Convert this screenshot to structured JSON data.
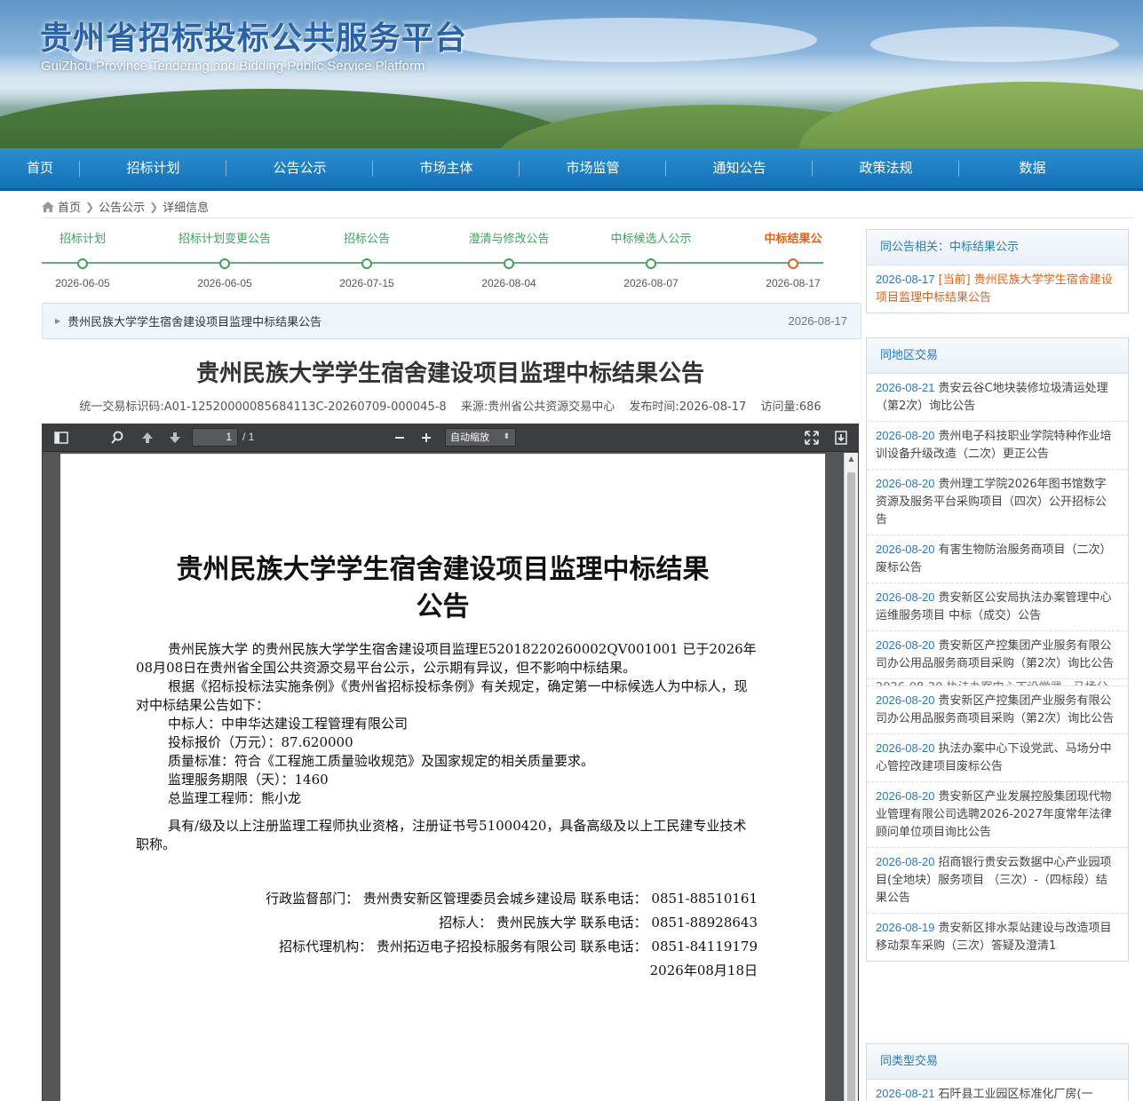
{
  "site": {
    "title": "贵州省招标投标公共服务平台",
    "subtitle": "GuiZhou Province Tendering and Bidding Public Service Platform"
  },
  "nav": [
    "首页",
    "招标计划",
    "公告公示",
    "市场主体",
    "市场监管",
    "通知公告",
    "政策法规",
    "数据"
  ],
  "breadcrumb": [
    "首页",
    "公告公示",
    "详细信息"
  ],
  "timeline": [
    {
      "label": "招标计划",
      "date": "2026-06-05"
    },
    {
      "label": "招标计划变更公告",
      "date": "2026-06-05"
    },
    {
      "label": "招标公告",
      "date": "2026-07-15"
    },
    {
      "label": "澄清与修改公告",
      "date": "2026-08-04"
    },
    {
      "label": "中标候选人公示",
      "date": "2026-08-07"
    },
    {
      "label": "中标结果公",
      "date": "2026-08-17",
      "current": true
    }
  ],
  "related_bar": {
    "title": "贵州民族大学学生宿舍建设项目监理中标结果公告",
    "date": "2026-08-17"
  },
  "article": {
    "title": "贵州民族大学学生宿舍建设项目监理中标结果公告",
    "trade_id": "统一交易标识码:A01-12520000085684113C-20260709-000045-8",
    "source": "来源:贵州省公共资源交易中心",
    "publish_time": "发布时间:2026-08-17",
    "visits": "访问量:686"
  },
  "pdf": {
    "page_current": "1",
    "page_total": "/ 1",
    "zoom": "自动缩放",
    "doc_title_line1": "贵州民族大学学生宿舍建设项目监理中标结果",
    "doc_title_line2": "公告",
    "para1": "贵州民族大学  的贵州民族大学学生宿舍建设项目监理E52018220260002QV001001  已于2026年08月08日在贵州省全国公共资源交易平台公示，公示期有异议，但不影响中标结果。",
    "para2": "根据《招标投标法实施条例》《贵州省招标投标条例》有关规定，确定第一中标候选人为中标人，现对中标结果公告如下：",
    "winner": "中标人：中申华达建设工程管理有限公司",
    "price": "投标报价（万元）：87.620000",
    "quality": "质量标准：符合《工程施工质量验收规范》及国家规定的相关质量要求。",
    "period": "监理服务期限（天）：1460",
    "chief": "总监理工程师：熊小龙",
    "qualification": "具有/级及以上注册监理工程师执业资格，注册证书号51000420，具备高级及以上工民建专业技术职称。",
    "footer": [
      "行政监督部门：  贵州贵安新区管理委员会城乡建设局  联系电话：  0851-88510161",
      "招标人：  贵州民族大学  联系电话：  0851-88928643",
      "招标代理机构：  贵州拓迈电子招投标服务有限公司  联系电话：  0851-84119179",
      "2026年08月18日"
    ]
  },
  "sidebar": {
    "same_notice": {
      "header": "同公告相关：中标结果公示",
      "items": [
        {
          "date": "2026-08-17",
          "text": "[当前] 贵州民族大学学生宿舍建设项目监理中标结果公告",
          "current": true
        }
      ]
    },
    "same_region": {
      "header": "同地区交易",
      "items": [
        {
          "date": "2026-08-21",
          "text": "贵安云谷C地块装修垃圾清运处理（第2次）询比公告"
        },
        {
          "date": "2026-08-20",
          "text": "贵州电子科技职业学院特种作业培训设备升级改造（二次）更正公告"
        },
        {
          "date": "2026-08-20",
          "text": "贵州理工学院2026年图书馆数字资源及服务平台采购项目（四次）公开招标公告"
        },
        {
          "date": "2026-08-20",
          "text": "有害生物防治服务商项目（二次）废标公告"
        },
        {
          "date": "2026-08-20",
          "text": "贵安新区公安局执法办案管理中心运维服务项目 中标（成交）公告"
        },
        {
          "date": "2026-08-20",
          "text": "贵安新区产控集团产业服务有限公司办公用品服务商项目采购（第2次）询比公告"
        }
      ],
      "overlap_text": "2026-08-20 执法办案中心下设党武、马场分",
      "items2": [
        {
          "date": "2026-08-20",
          "text": "贵安新区产控集团产业服务有限公司办公用品服务商项目采购（第2次）询比公告"
        },
        {
          "date": "2026-08-20",
          "text": "执法办案中心下设党武、马场分中心管控改建项目废标公告"
        },
        {
          "date": "2026-08-20",
          "text": "贵安新区产业发展控股集团现代物业管理有限公司选聘2026-2027年度常年法律顾问单位项目询比公告"
        },
        {
          "date": "2026-08-20",
          "text": "招商银行贵安云数据中心产业园项目(全地块）服务项目 （三次）-（四标段）结果公告"
        },
        {
          "date": "2026-08-19",
          "text": "贵安新区排水泵站建设与改造项目移动泵车采购（三次）答疑及澄清1"
        }
      ]
    },
    "same_type": {
      "header": "同类型交易",
      "items": [
        {
          "date": "2026-08-21",
          "text": "石阡县工业园区标准化厂房(一"
        }
      ]
    }
  },
  "colors": {
    "nav": "#1f82c6",
    "accent_green": "#3aa35a",
    "accent_orange": "#e4611b",
    "link_blue": "#2a78c2"
  }
}
